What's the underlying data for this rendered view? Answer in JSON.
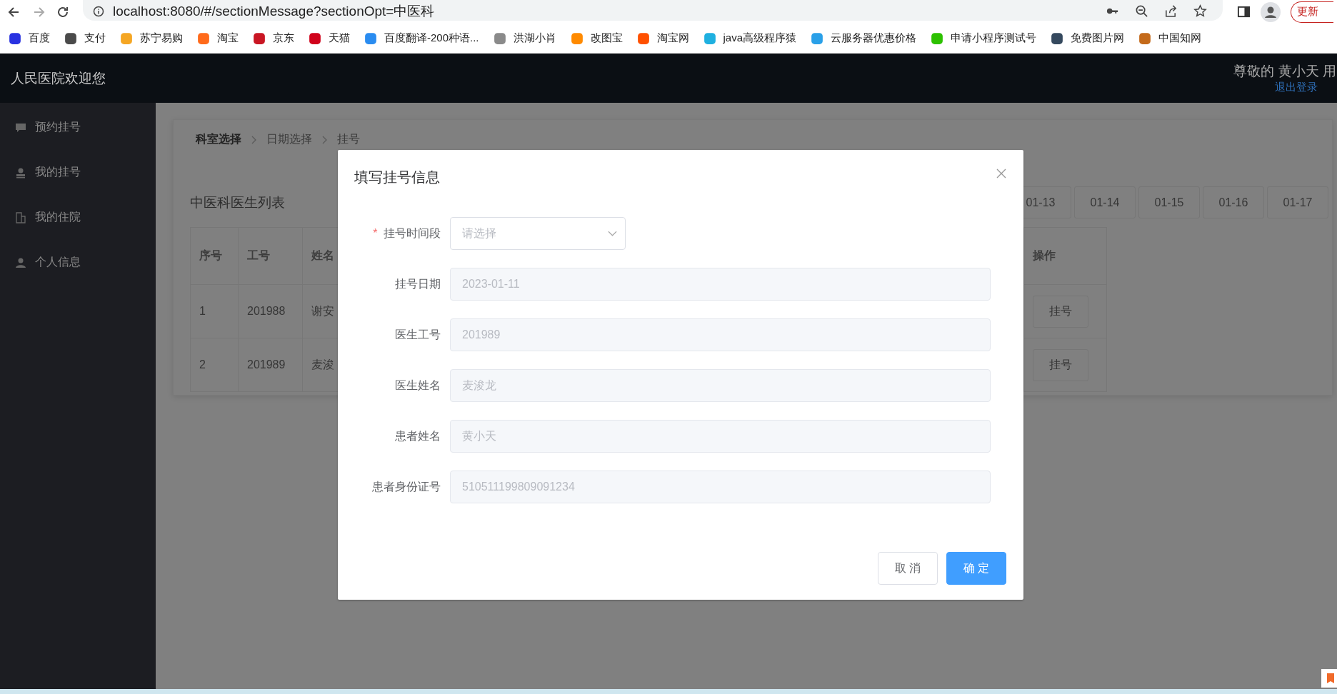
{
  "browser": {
    "url": "localhost:8080/#/sectionMessage?sectionOpt=中医科",
    "update_button": "更新",
    "bookmarks": [
      {
        "label": "百度",
        "color": "#2932e1"
      },
      {
        "label": "支付",
        "color": "#4a4a4a"
      },
      {
        "label": "苏宁易购",
        "color": "#f5a623"
      },
      {
        "label": "淘宝",
        "color": "#ff6a1a"
      },
      {
        "label": "京东",
        "color": "#c91623"
      },
      {
        "label": "天猫",
        "color": "#d0021b"
      },
      {
        "label": "百度翻译-200种语...",
        "color": "#2a8cf0"
      },
      {
        "label": "洪湖小肖",
        "color": "#8a8a8a"
      },
      {
        "label": "改图宝",
        "color": "#ff8a00"
      },
      {
        "label": "淘宝网",
        "color": "#ff5000"
      },
      {
        "label": "java高级程序猿",
        "color": "#1fb0e0"
      },
      {
        "label": "云服务器优惠价格",
        "color": "#2aa0e8"
      },
      {
        "label": "申请小程序测试号",
        "color": "#2dc100"
      },
      {
        "label": "免费图片网",
        "color": "#35495e"
      },
      {
        "label": "中国知网",
        "color": "#c46a1a"
      }
    ]
  },
  "header": {
    "title": "人民医院欢迎您",
    "greeting": "尊敬的 黄小天 用",
    "logout": "退出登录"
  },
  "sidebar": {
    "items": [
      {
        "label": "预约挂号",
        "kind": "chat"
      },
      {
        "label": "我的挂号",
        "kind": "user"
      },
      {
        "label": "我的住院",
        "kind": "building"
      },
      {
        "label": "个人信息",
        "kind": "person"
      }
    ]
  },
  "content": {
    "breadcrumb": [
      {
        "label": "科室选择",
        "link": true
      },
      {
        "label": "日期选择",
        "link": false
      },
      {
        "label": "挂号",
        "link": false
      }
    ],
    "list_title": "中医科医生列表",
    "dates": [
      "01-13",
      "01-14",
      "01-15",
      "01-16",
      "01-17"
    ],
    "table": {
      "columns": [
        "序号",
        "工号",
        "姓名",
        "操作"
      ],
      "rows": [
        {
          "cells": [
            "1",
            "201988",
            "谢安"
          ],
          "action": "挂号"
        },
        {
          "cells": [
            "2",
            "201989",
            "麦浚"
          ],
          "action": "挂号"
        }
      ]
    }
  },
  "dialog": {
    "title": "填写挂号信息",
    "required_mark": "*",
    "fields": [
      {
        "label": "挂号时间段",
        "kind": "select",
        "required": true,
        "placeholder": "请选择"
      },
      {
        "label": "挂号日期",
        "kind": "input",
        "required": false,
        "value": "2023-01-11"
      },
      {
        "label": "医生工号",
        "kind": "input",
        "required": false,
        "value": "201989"
      },
      {
        "label": "医生姓名",
        "kind": "input",
        "required": false,
        "value": "麦浚龙"
      },
      {
        "label": "患者姓名",
        "kind": "input",
        "required": false,
        "value": "黄小天"
      },
      {
        "label": "患者身份证号",
        "kind": "input",
        "required": false,
        "value": "510511199809091234"
      }
    ],
    "buttons": [
      {
        "label": "取 消",
        "kind": "default"
      },
      {
        "label": "确 定",
        "kind": "primary"
      }
    ]
  }
}
